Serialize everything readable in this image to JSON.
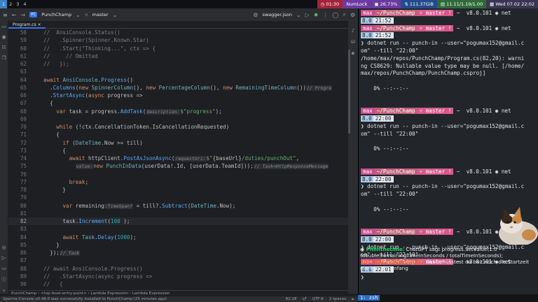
{
  "topbar": {
    "workspaces": [
      "1",
      "2",
      "3",
      "4"
    ],
    "clock_time": "01:30",
    "numlock": "NumLock",
    "disk": "26.73%",
    "network": "111.37GiB",
    "ip": "11.11/1.19/1.00",
    "datetime": "Wed 07.02 22:02"
  },
  "ide": {
    "project_badge": "PC",
    "project_name": "PunchChamp",
    "branch": "master",
    "config": "swagger.json",
    "tab": "Program.cs",
    "breadcrumb": [
      "PunchChamp",
      "<top-level-entry-point>",
      "Lambda Expression",
      "Lambda Expression"
    ],
    "status_message": "Spectre.Console v0.48.0 was successfully installed to PunchChamp (25 minutes ago)",
    "cursor_pos": "82:28",
    "line_ending": "LF",
    "encoding": "UTF-8",
    "indent": "2 spaces"
  },
  "code_lines": [
    {
      "n": "58",
      "html": "<span class=\"cm\">//  AnsiConsole.Status()</span>"
    },
    {
      "n": "59",
      "html": "<span class=\"cm\">//   .Spinner(Spinner.Known.Star)</span>"
    },
    {
      "n": "60",
      "html": "<span class=\"cm\">//   .Start(\"Thinking...\", ctx => {</span>"
    },
    {
      "n": "61",
      "html": "<span class=\"cm\">//     // Omitted</span>"
    },
    {
      "n": "62",
      "html": "<span class=\"cm\">//   });</span>"
    },
    {
      "n": "63",
      "html": ""
    },
    {
      "n": "64",
      "html": "<span class=\"kw\">await</span> <span class=\"ty\">AnsiConsole</span>.<span class=\"me\">Progress</span>()"
    },
    {
      "n": "65",
      "html": "  .<span class=\"me\">Columns</span>(<span class=\"kw\">new</span> <span class=\"ty\">SpinnerColumn</span>(), <span class=\"kw\">new</span> <span class=\"ty\">PercentageColumn</span>(), <span class=\"kw\">new</span> <span class=\"ty\">RemainingTimeColumn</span>())<span class=\"hint\">// Progre</span>"
    },
    {
      "n": "66",
      "html": "  .<span class=\"me\">StartAsync</span>(<span class=\"kw\">async</span> progress =>"
    },
    {
      "n": "67",
      "html": "  {"
    },
    {
      "n": "68",
      "html": "    <span class=\"kw\">var</span> task = progress.<span class=\"me\">AddTask</span>(<span class=\"hint\">description:</span><span class=\"st\">$\"progress\"</span>);"
    },
    {
      "n": "69",
      "html": ""
    },
    {
      "n": "70",
      "html": "    <span class=\"kw\">while</span> (!ctx.CancellationToken.IsCancellationRequested)"
    },
    {
      "n": "71",
      "html": "    {"
    },
    {
      "n": "72",
      "html": "      <span class=\"kw\">if</span> (<span class=\"ty\">DateTime</span>.Now >= till)"
    },
    {
      "n": "73",
      "html": "      {"
    },
    {
      "n": "74",
      "html": "        <span class=\"kw\">await</span> httpClient.<span class=\"me\">PostAsJsonAsync</span>(<span class=\"hint\">requestUri:</span><span class=\"st\">$\"</span>{baseUrl}<span class=\"st\">/duties/punchOut\"</span>,"
    },
    {
      "n": "75",
      "html": "          <span class=\"hint\">value:</span><span class=\"kw\">new</span> <span class=\"ty\">PunchInData</span>(userData!.Id, [userData.TeamId]));<span class=\"hint\">// Task&lt;HttpResponseMessage</span>"
    },
    {
      "n": "76",
      "html": ""
    },
    {
      "n": "77",
      "html": "        <span class=\"kw\">break</span>;"
    },
    {
      "n": "78",
      "html": "      }"
    },
    {
      "n": "79",
      "html": ""
    },
    {
      "n": "80",
      "html": "      <span class=\"kw\">var</span> remaining<span class=\"hint\">:TimeSpan?</span> = till?.<span class=\"me\">Subtract</span>(<span class=\"ty\">DateTime</span>.Now);"
    },
    {
      "n": "81",
      "html": ""
    },
    {
      "n": "82",
      "html": "      task.<span class=\"me\">Increment</span>(<span class=\"nb\">100</span> );"
    },
    {
      "n": "83",
      "html": ""
    },
    {
      "n": "84",
      "html": "      <span class=\"kw\">await</span> <span class=\"ty\">Task</span>.<span class=\"me\">Delay</span>(<span class=\"nb\">1000</span>);"
    },
    {
      "n": "85",
      "html": "    }"
    },
    {
      "n": "86",
      "html": "  });<span class=\"hint\">// Task</span>"
    },
    {
      "n": "87",
      "html": ""
    },
    {
      "n": "88",
      "html": "<span class=\"cm\">// await AnsiConsole.Progress()</span>"
    },
    {
      "n": "89",
      "html": "<span class=\"cm\">//   .StartAsync(async progress =></span>"
    },
    {
      "n": "90",
      "html": "<span class=\"cm\">//   {</span>"
    }
  ],
  "terminal": {
    "prompt_user": "max",
    "prompt_path": "~/PunchChamp",
    "prompt_git": "master !",
    "prompt_tilde": "~",
    "prompt_version": "v8.0.101",
    "prompt_net": "net",
    "version_short": "8.0",
    "lines": [
      {
        "type": "p1"
      },
      {
        "type": "p2",
        "time": "21:52"
      },
      {
        "type": "p1"
      },
      {
        "type": "p2",
        "time": "21:52"
      },
      {
        "type": "text",
        "text": "❯ dotnet run -- punch-in --user=\"pogumax152@gmail.c"
      },
      {
        "type": "text",
        "text": "om\" --till \"22:00\""
      },
      {
        "type": "text",
        "text": "/home/max/repos/PunchChamp/Program.cs(82,20): warni"
      },
      {
        "type": "text",
        "text": "ng CS8629: Nullable value type may be null. [/home/"
      },
      {
        "type": "text",
        "text": "max/repos/PunchChamp/PunchChamp.csproj]"
      },
      {
        "type": "blank"
      },
      {
        "type": "text",
        "text": "    0% --:--:--"
      },
      {
        "type": "blank"
      },
      {
        "type": "blank"
      },
      {
        "type": "p1"
      },
      {
        "type": "p2",
        "time": "22:00"
      },
      {
        "type": "text",
        "text": "❯ dotnet run -- punch-in --user=\"pogumax152@gmail.c"
      },
      {
        "type": "text",
        "text": "om\" --till \"22:00\""
      },
      {
        "type": "blank"
      },
      {
        "type": "text",
        "text": "    0% --:--:--"
      },
      {
        "type": "blank"
      },
      {
        "type": "blank"
      },
      {
        "type": "p1"
      },
      {
        "type": "p2",
        "time": "22:00"
      },
      {
        "type": "text",
        "text": "❯ dotnet run -- punch-in --user=\"pogumax152@gmail.c"
      },
      {
        "type": "text",
        "text": "om\" --till \"22:00\""
      },
      {
        "type": "blank"
      },
      {
        "type": "text",
        "text": "    0% --:--:--"
      },
      {
        "type": "blank"
      },
      {
        "type": "blank"
      },
      {
        "type": "p1"
      },
      {
        "type": "p2",
        "time": "22:00"
      },
      {
        "type": "text",
        "text": "❯ dotnet run -- punch-in --user=\"pogumax152@gmail.c"
      },
      {
        "type": "text",
        "text": "om\" --till \"22:10\""
      }
    ],
    "last_prompt_time": "22:01",
    "cursor": "❯",
    "tmux_window": "1: zsh"
  },
  "chat": [
    {
      "name": "Phlinthetime",
      "text": ": ChatGPT sagt progress.SetValue(1.0 - (double)remainingTimeInSeconds / totalTimeInSeconds);"
    },
    {
      "name": "1GallonCokeZeroADay",
      "text": ": dann müsstest du halt noch die Startzeit merken am Anfang"
    }
  ]
}
